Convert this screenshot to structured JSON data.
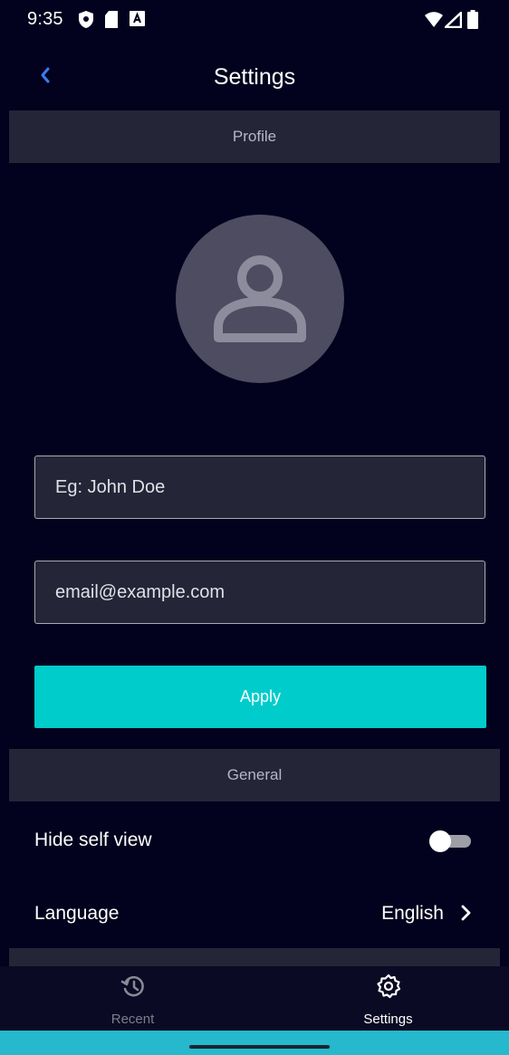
{
  "status_bar": {
    "time": "9:35",
    "left_icons": [
      "shield-icon",
      "sd-card-icon",
      "text-a-icon"
    ],
    "right_icons": [
      "wifi-icon",
      "signal-icon",
      "battery-icon"
    ]
  },
  "header": {
    "title": "Settings",
    "back_icon": "chevron-left-icon"
  },
  "profile": {
    "section_label": "Profile",
    "avatar_icon": "person-icon",
    "name_placeholder": "Eg: John Doe",
    "email_placeholder": "email@example.com",
    "apply_label": "Apply"
  },
  "general": {
    "section_label": "General",
    "hide_self_view_label": "Hide self view",
    "hide_self_view_enabled": false,
    "language_label": "Language",
    "language_value": "English"
  },
  "bottom_nav": {
    "items": [
      {
        "label": "Recent",
        "icon": "history-icon",
        "active": false
      },
      {
        "label": "Settings",
        "icon": "gear-icon",
        "active": true
      }
    ]
  },
  "colors": {
    "background": "#03021e",
    "section_bar": "#252538",
    "accent": "#00cccc",
    "avatar": "#4d4c60",
    "back_icon": "#3d7bf0",
    "gesture_bar": "#26b8cc"
  }
}
